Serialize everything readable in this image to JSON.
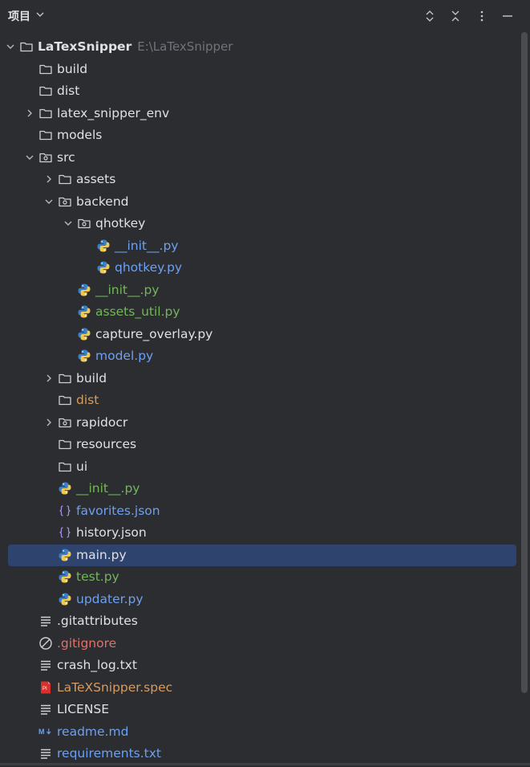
{
  "header": {
    "title": "项目",
    "icons": [
      "chevron-down-icon",
      "expand-collapse-icon",
      "collapse-all-icon",
      "more-vertical-icon",
      "minimize-icon"
    ]
  },
  "colors": {
    "default": "#dfe1e5",
    "modified": "#6ea0f0",
    "added": "#73b65a",
    "ignored": "#d99a5e",
    "deleted": "#e0726b",
    "selection": "#2e436e"
  },
  "tree": [
    {
      "label": "LaTexSnipper",
      "hint": "E:\\LaTexSnipper",
      "depth": 0,
      "icon": "folder",
      "chevron": "down",
      "status": "default",
      "bold": true
    },
    {
      "label": "build",
      "depth": 1,
      "icon": "folder",
      "chevron": "none",
      "status": "default"
    },
    {
      "label": "dist",
      "depth": 1,
      "icon": "folder",
      "chevron": "none",
      "status": "default"
    },
    {
      "label": "latex_snipper_env",
      "depth": 1,
      "icon": "folder",
      "chevron": "right",
      "status": "default"
    },
    {
      "label": "models",
      "depth": 1,
      "icon": "folder",
      "chevron": "none",
      "status": "default"
    },
    {
      "label": "src",
      "depth": 1,
      "icon": "package",
      "chevron": "down",
      "status": "default"
    },
    {
      "label": "assets",
      "depth": 2,
      "icon": "folder",
      "chevron": "right",
      "status": "default"
    },
    {
      "label": "backend",
      "depth": 2,
      "icon": "package",
      "chevron": "down",
      "status": "default"
    },
    {
      "label": "qhotkey",
      "depth": 3,
      "icon": "package",
      "chevron": "down",
      "status": "default"
    },
    {
      "label": "__init__.py",
      "depth": 4,
      "icon": "python",
      "chevron": "none",
      "status": "modified"
    },
    {
      "label": "qhotkey.py",
      "depth": 4,
      "icon": "python",
      "chevron": "none",
      "status": "modified"
    },
    {
      "label": "__init__.py",
      "depth": 3,
      "icon": "python",
      "chevron": "none",
      "status": "added"
    },
    {
      "label": "assets_util.py",
      "depth": 3,
      "icon": "python",
      "chevron": "none",
      "status": "added"
    },
    {
      "label": "capture_overlay.py",
      "depth": 3,
      "icon": "python",
      "chevron": "none",
      "status": "default"
    },
    {
      "label": "model.py",
      "depth": 3,
      "icon": "python",
      "chevron": "none",
      "status": "modified"
    },
    {
      "label": "build",
      "depth": 2,
      "icon": "folder",
      "chevron": "right",
      "status": "default"
    },
    {
      "label": "dist",
      "depth": 2,
      "icon": "folder",
      "chevron": "none",
      "status": "ignored"
    },
    {
      "label": "rapidocr",
      "depth": 2,
      "icon": "package",
      "chevron": "right",
      "status": "default"
    },
    {
      "label": "resources",
      "depth": 2,
      "icon": "folder",
      "chevron": "none",
      "status": "default"
    },
    {
      "label": "ui",
      "depth": 2,
      "icon": "folder",
      "chevron": "none",
      "status": "default"
    },
    {
      "label": "__init__.py",
      "depth": 2,
      "icon": "python",
      "chevron": "none",
      "status": "added"
    },
    {
      "label": "favorites.json",
      "depth": 2,
      "icon": "json",
      "chevron": "none",
      "status": "modified"
    },
    {
      "label": "history.json",
      "depth": 2,
      "icon": "json",
      "chevron": "none",
      "status": "default"
    },
    {
      "label": "main.py",
      "depth": 2,
      "icon": "python",
      "chevron": "none",
      "status": "default",
      "selected": true
    },
    {
      "label": "test.py",
      "depth": 2,
      "icon": "python",
      "chevron": "none",
      "status": "added"
    },
    {
      "label": "updater.py",
      "depth": 2,
      "icon": "python",
      "chevron": "none",
      "status": "modified"
    },
    {
      "label": ".gitattributes",
      "depth": 1,
      "icon": "text",
      "chevron": "none",
      "status": "default"
    },
    {
      "label": ".gitignore",
      "depth": 1,
      "icon": "ignore",
      "chevron": "none",
      "status": "deleted"
    },
    {
      "label": "crash_log.txt",
      "depth": 1,
      "icon": "text",
      "chevron": "none",
      "status": "default"
    },
    {
      "label": "LaTeXSnipper.spec",
      "depth": 1,
      "icon": "spec",
      "chevron": "none",
      "status": "ignored"
    },
    {
      "label": "LICENSE",
      "depth": 1,
      "icon": "text",
      "chevron": "none",
      "status": "default"
    },
    {
      "label": "readme.md",
      "depth": 1,
      "icon": "markdown",
      "chevron": "none",
      "status": "modified"
    },
    {
      "label": "requirements.txt",
      "depth": 1,
      "icon": "text",
      "chevron": "none",
      "status": "modified"
    }
  ]
}
